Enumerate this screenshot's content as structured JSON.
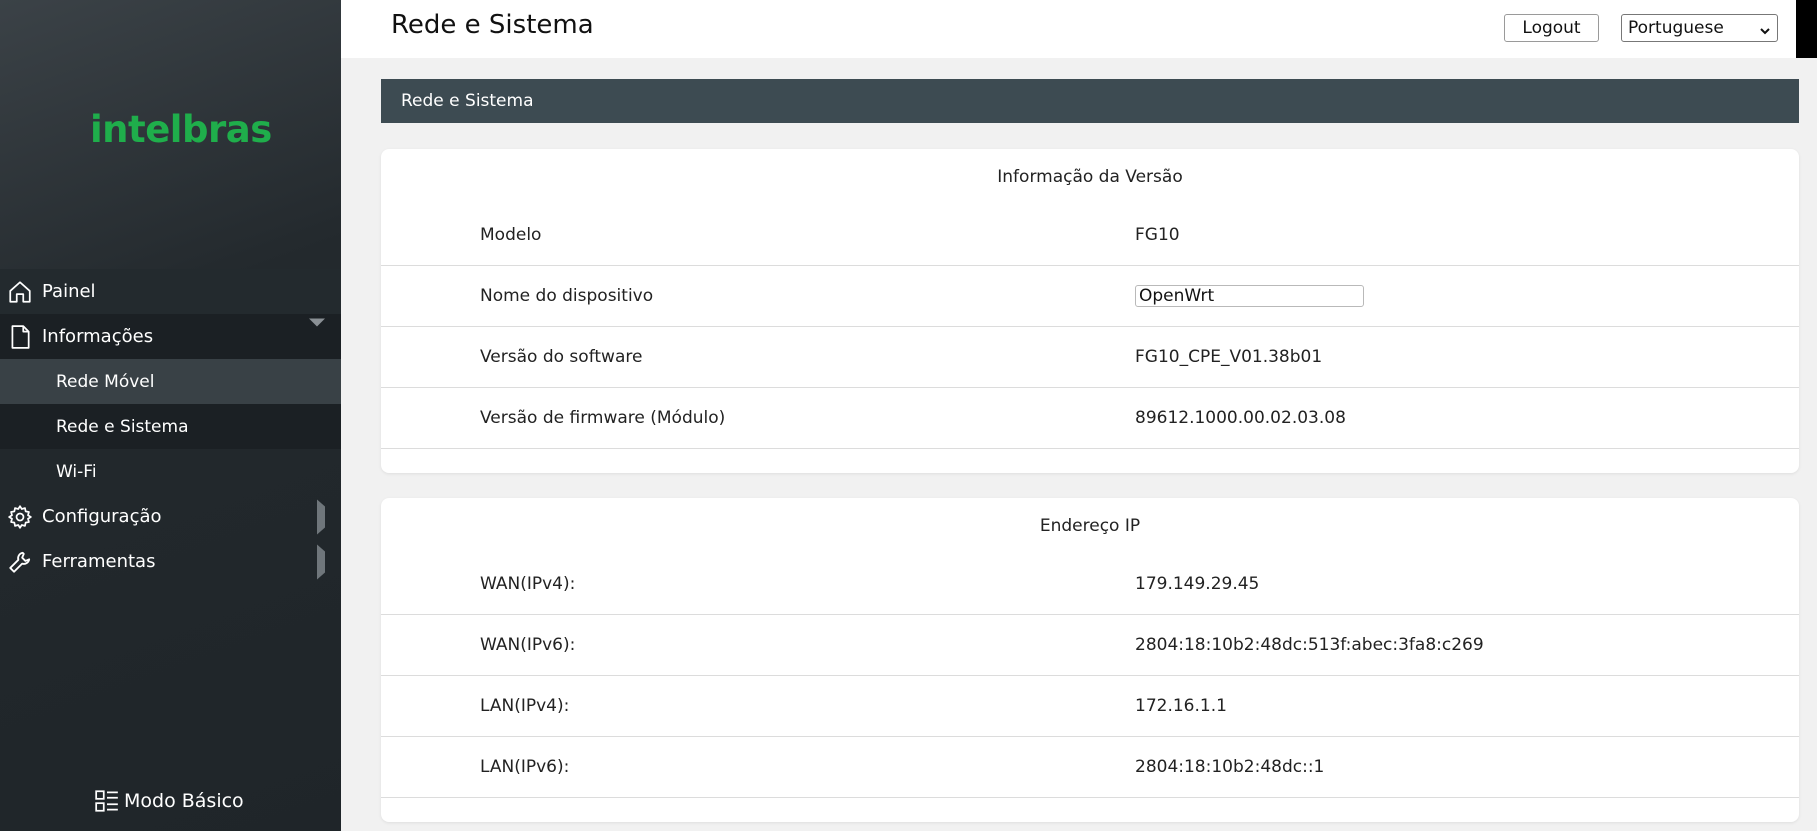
{
  "sidebar": {
    "logo": "intelbras",
    "items": [
      {
        "label": "Painel",
        "icon": "home-icon"
      },
      {
        "label": "Informações",
        "icon": "document-icon"
      },
      {
        "label": "Rede Móvel"
      },
      {
        "label": "Rede e Sistema"
      },
      {
        "label": "Wi-Fi"
      },
      {
        "label": "Configuração",
        "icon": "gear-icon"
      },
      {
        "label": "Ferramentas",
        "icon": "wrench-icon"
      }
    ],
    "mode_label": "Modo Básico"
  },
  "header": {
    "title": "Rede e Sistema",
    "logout_label": "Logout",
    "language": "Portuguese"
  },
  "section": {
    "title": "Rede e Sistema"
  },
  "version_card": {
    "title": "Informação da Versão",
    "rows": [
      {
        "label": "Modelo",
        "value": "FG10"
      },
      {
        "label": "Nome do dispositivo",
        "value": "OpenWrt"
      },
      {
        "label": "Versão do software",
        "value": "FG10_CPE_V01.38b01"
      },
      {
        "label": "Versão de firmware (Módulo)",
        "value": "89612.1000.00.02.03.08"
      }
    ]
  },
  "ip_card": {
    "title": "Endereço IP",
    "rows": [
      {
        "label": "WAN(IPv4):",
        "value": "179.149.29.45"
      },
      {
        "label": "WAN(IPv6):",
        "value": "2804:18:10b2:48dc:513f:abec:3fa8:c269"
      },
      {
        "label": "LAN(IPv4):",
        "value": "172.16.1.1"
      },
      {
        "label": "LAN(IPv6):",
        "value": "2804:18:10b2:48dc::1"
      }
    ]
  },
  "colors": {
    "brand_green": "#1fae4b",
    "section_bar": "#3d4b52",
    "sidebar_dark": "#1f2529"
  }
}
